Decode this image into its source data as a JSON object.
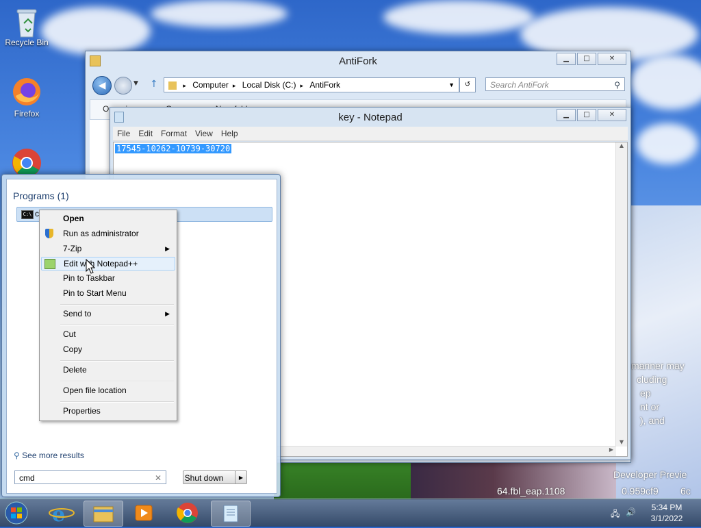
{
  "desktop": {
    "icons": [
      {
        "label": "Recycle Bin",
        "icon": "recycle-bin-icon"
      },
      {
        "label": "Firefox",
        "icon": "firefox-icon"
      },
      {
        "label": "",
        "icon": "chrome-icon"
      }
    ],
    "watermark": {
      "lines": [
        "manner may",
        "cluding",
        "ep",
        "nt or",
        "), and"
      ],
      "build_line1": "Developer Previe",
      "build_line2": "64.fbl_eap.1108",
      "build_line3": "0.959cf9",
      "build_line4": "6c"
    }
  },
  "explorer": {
    "title": "AntiFork",
    "breadcrumb": [
      "Computer",
      "Local Disk (C:)",
      "AntiFork"
    ],
    "search_placeholder": "Search AntiFork",
    "toolbar": {
      "organize": "Organize",
      "open": "Open",
      "new_folder": "New folder"
    }
  },
  "notepad": {
    "title": "key - Notepad",
    "menu": [
      "File",
      "Edit",
      "Format",
      "View",
      "Help"
    ],
    "content": "17545-10262-10739-30720"
  },
  "startmenu": {
    "section_header": "Programs (1)",
    "result_label": "cmd",
    "see_more": "See more results",
    "search_value": "cmd",
    "shutdown_label": "Shut down"
  },
  "context_menu": {
    "items": [
      {
        "label": "Open",
        "bold": true
      },
      {
        "label": "Run as administrator",
        "icon": "uac-shield-icon"
      },
      {
        "label": "7-Zip",
        "submenu": true
      },
      {
        "label": "Edit with Notepad++",
        "icon": "notepadpp-icon",
        "hover": true
      },
      {
        "label": "Pin to Taskbar"
      },
      {
        "label": "Pin to Start Menu"
      },
      {
        "label": "Send to",
        "submenu": true
      },
      {
        "label": "Cut"
      },
      {
        "label": "Copy"
      },
      {
        "label": "Delete"
      },
      {
        "label": "Open file location"
      },
      {
        "label": "Properties"
      }
    ]
  },
  "taskbar": {
    "items": [
      "start-orb-icon",
      "internet-explorer-icon",
      "windows-explorer-icon",
      "media-player-icon",
      "chrome-icon",
      "notepad-icon"
    ],
    "clock_time": "5:34 PM",
    "clock_date": "3/1/2022"
  }
}
